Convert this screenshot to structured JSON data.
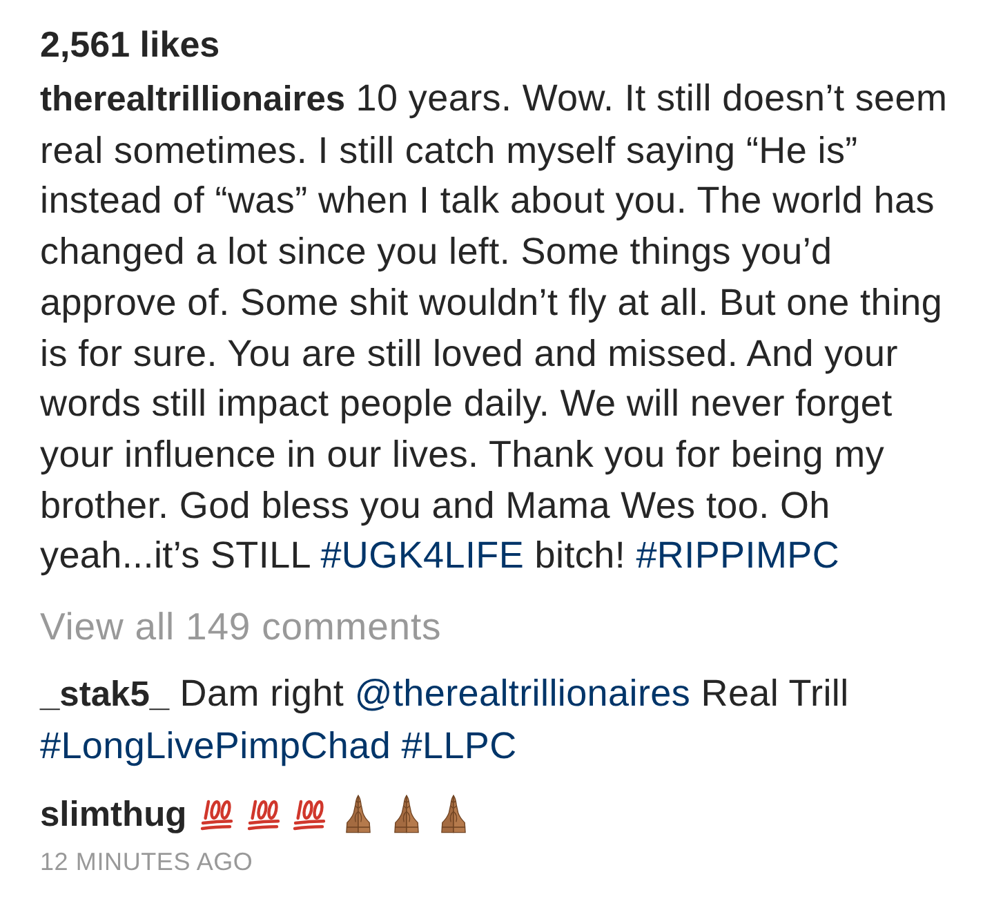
{
  "likes": "2,561 likes",
  "caption": {
    "username": "therealtrillionaires",
    "segments": [
      {
        "kind": "text",
        "text": "10 years. Wow. It still doesn’t seem real sometimes. I still catch myself saying “He is” instead of “was” when I talk about you. The world has changed a lot since you left. Some things you’d approve of. Some shit wouldn’t fly at all. But one thing is for sure. You are still loved and missed. And your words still impact people daily. We will never forget your influence in our lives. Thank you for being my brother. God bless you and Mama Wes too. Oh yeah...it’s STILL"
      },
      {
        "kind": "hashtag",
        "text": "#UGK4LIFE"
      },
      {
        "kind": "text",
        "text": "bitch!"
      },
      {
        "kind": "hashtag",
        "text": "#RIPPIMPC"
      }
    ]
  },
  "view_comments": "View all 149 comments",
  "comments": [
    {
      "username": "_stak5_",
      "segments": [
        {
          "kind": "text",
          "text": "Dam right"
        },
        {
          "kind": "mention",
          "text": "@therealtrillionaires"
        },
        {
          "kind": "text",
          "text": "Real Trill"
        },
        {
          "kind": "hashtag",
          "text": "#LongLivePimpChad"
        },
        {
          "kind": "hashtag",
          "text": "#LLPC"
        }
      ]
    },
    {
      "username": "slimthug",
      "segments": [
        {
          "kind": "hundred-points"
        },
        {
          "kind": "hundred-points"
        },
        {
          "kind": "hundred-points"
        },
        {
          "kind": "folded-hands"
        },
        {
          "kind": "folded-hands"
        },
        {
          "kind": "folded-hands"
        }
      ]
    }
  ],
  "timestamp": "12 MINUTES AGO"
}
